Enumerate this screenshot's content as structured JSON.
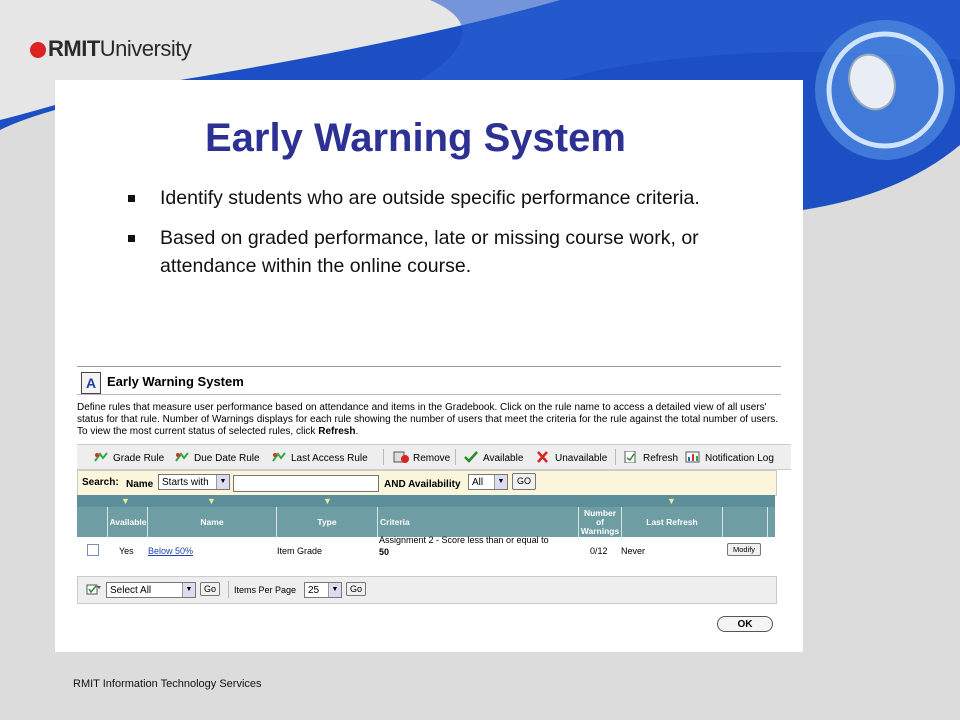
{
  "slide": {
    "logo_bold": "RMIT",
    "logo_rest": "University",
    "title": "Early Warning System",
    "bullets": [
      "Identify students who are outside specific performance criteria.",
      "Based on graded performance, late or missing course work, or attendance within the online course."
    ],
    "footer": "RMIT Information Technology Services"
  },
  "screen": {
    "title": "Early Warning System",
    "description_pre": "Define rules that measure user performance based on attendance and items in the Gradebook. Click on the rule name to access a detailed view of all users' status for that rule. Number of Warnings displays for each rule showing the number of users that meet the criteria for the rule against the total number of users. To view the most current status of selected rules, click ",
    "description_bold": "Refresh",
    "description_post": ".",
    "toolbar": {
      "grade_rule": "Grade Rule",
      "due_date_rule": "Due Date Rule",
      "last_access_rule": "Last Access Rule",
      "remove": "Remove",
      "available": "Available",
      "unavailable": "Unavailable",
      "refresh": "Refresh",
      "notification_log": "Notification Log"
    },
    "search": {
      "search_label": "Search:",
      "name_label": "Name",
      "match_value": "Starts with",
      "text_value": "",
      "availability_label": "AND Availability",
      "availability_value": "All",
      "go": "GO"
    },
    "columns": [
      "Available",
      "Name",
      "Type",
      "Criteria",
      "Number of Warnings",
      "Last Refresh"
    ],
    "rows": [
      {
        "available": "Yes",
        "name": "Below 50%",
        "type": "Item Grade",
        "criteria_text": "Assignment 2 - Score less than or equal to",
        "criteria_value": "50",
        "warnings": "0/12",
        "last_refresh": "Never",
        "action": "Modify"
      }
    ],
    "bottom": {
      "select_value": "Select All",
      "go": "Go",
      "items_per_page_label": "Items Per Page",
      "items_per_page_value": "25",
      "go2": "Go"
    },
    "ok": "OK"
  },
  "colors": {
    "title": "#2d3194",
    "header_teal": "#6e9ea4",
    "search_bg": "#fbf5dc",
    "slide_blue": "#1d4fc4"
  }
}
